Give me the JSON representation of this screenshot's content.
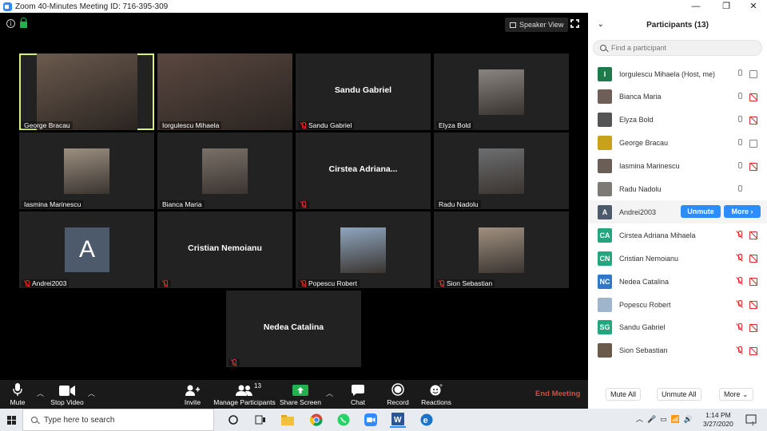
{
  "window": {
    "title": "Zoom 40-Minutes Meeting ID: 716-395-309",
    "minimize": "—",
    "maximize": "❐",
    "close": "✕"
  },
  "meeting": {
    "speaker_view_label": "Speaker View",
    "tiles": [
      {
        "name": "George Bracau",
        "video": true,
        "active": true,
        "muted": false,
        "photo_bg": "#6b5a4e"
      },
      {
        "name": "Iorgulescu Mihaela",
        "video": true,
        "active": false,
        "muted": false,
        "photo_bg": "#5a4740"
      },
      {
        "name": "Sandu Gabriel",
        "video": false,
        "muted": true,
        "big": "Sandu Gabriel"
      },
      {
        "name": "Elyza Bold",
        "video": true,
        "muted": false,
        "small_photo": true,
        "photo_bg": "#8a8480"
      },
      {
        "name": "Iasmina Marinescu",
        "video": true,
        "muted": false,
        "small_photo": true,
        "photo_bg": "#9c8f80"
      },
      {
        "name": "Bianca Maria",
        "video": true,
        "muted": false,
        "small_photo": true,
        "photo_bg": "#7a7068"
      },
      {
        "name": "",
        "video": false,
        "muted": true,
        "big": "Cirstea  Adriana..."
      },
      {
        "name": "Radu Nadolu",
        "video": true,
        "muted": false,
        "small_photo": true,
        "photo_bg": "#6c6e70"
      },
      {
        "name": "Andrei2003",
        "video": false,
        "muted": true,
        "avatar": "A"
      },
      {
        "name": "",
        "video": false,
        "muted": true,
        "big": "Cristian Nemoianu"
      },
      {
        "name": "Popescu Robert",
        "video": true,
        "muted": true,
        "small_photo": true,
        "photo_bg": "#8fa6bf"
      },
      {
        "name": "Sion Sebastian",
        "video": true,
        "muted": true,
        "small_photo": true,
        "photo_bg": "#a09080"
      },
      {
        "name": "",
        "video": false,
        "muted": true,
        "big": "Nedea Catalina"
      }
    ]
  },
  "toolbar": {
    "mute": "Mute",
    "stop_video": "Stop Video",
    "invite": "Invite",
    "manage_participants": "Manage Participants",
    "participant_count": "13",
    "share_screen": "Share Screen",
    "chat": "Chat",
    "record": "Record",
    "reactions": "Reactions",
    "end_meeting": "End Meeting"
  },
  "participants_panel": {
    "title": "Participants (13)",
    "search_placeholder": "Find a participant",
    "list": [
      {
        "name": "Iorgulescu Mihaela (Host, me)",
        "initials": "I",
        "color": "#1e7a4a",
        "mic": "on",
        "cam": "on"
      },
      {
        "name": "Bianca Maria",
        "initials": "",
        "color": "#6e5f58",
        "mic": "on",
        "cam": "off"
      },
      {
        "name": "Elyza Bold",
        "initials": "",
        "color": "#555555",
        "mic": "on",
        "cam": "off"
      },
      {
        "name": "George Bracau",
        "initials": "",
        "color": "#c9a21c",
        "mic": "on",
        "cam": "on"
      },
      {
        "name": "Iasmina Marinescu",
        "initials": "",
        "color": "#6a5e56",
        "mic": "on",
        "cam": "off"
      },
      {
        "name": "Radu Nadolu",
        "initials": "",
        "color": "#7d7a76",
        "mic": "on",
        "cam": "none"
      },
      {
        "name": "Andrei2003",
        "initials": "A",
        "color": "#4d5a6c",
        "mic": "none",
        "cam": "none",
        "highlight": true
      },
      {
        "name": "Cirstea Adriana Mihaela",
        "initials": "CA",
        "color": "#23a57d",
        "mic": "off",
        "cam": "off"
      },
      {
        "name": "Cristian Nemoianu",
        "initials": "CN",
        "color": "#23a57d",
        "mic": "off",
        "cam": "off"
      },
      {
        "name": "Nedea Catalina",
        "initials": "NC",
        "color": "#2e78c7",
        "mic": "off",
        "cam": "off"
      },
      {
        "name": "Popescu Robert",
        "initials": "",
        "color": "#9fb5cc",
        "mic": "off",
        "cam": "off"
      },
      {
        "name": "Sandu Gabriel",
        "initials": "SG",
        "color": "#23a57d",
        "mic": "off",
        "cam": "off"
      },
      {
        "name": "Sion Sebastian",
        "initials": "",
        "color": "#6a5a4c",
        "mic": "off",
        "cam": "off"
      }
    ],
    "unmute_label": "Unmute",
    "more_label": "More ›",
    "mute_all": "Mute All",
    "unmute_all": "Unmute All",
    "footer_more": "More ⌄"
  },
  "taskbar": {
    "search_placeholder": "Type here to search",
    "time": "1:14 PM",
    "date": "3/27/2020"
  },
  "colors": {
    "accent": "#2d8cff",
    "active_speaker": "#d8f07a",
    "end_meeting": "#e0463f",
    "muted": "#e02828"
  }
}
